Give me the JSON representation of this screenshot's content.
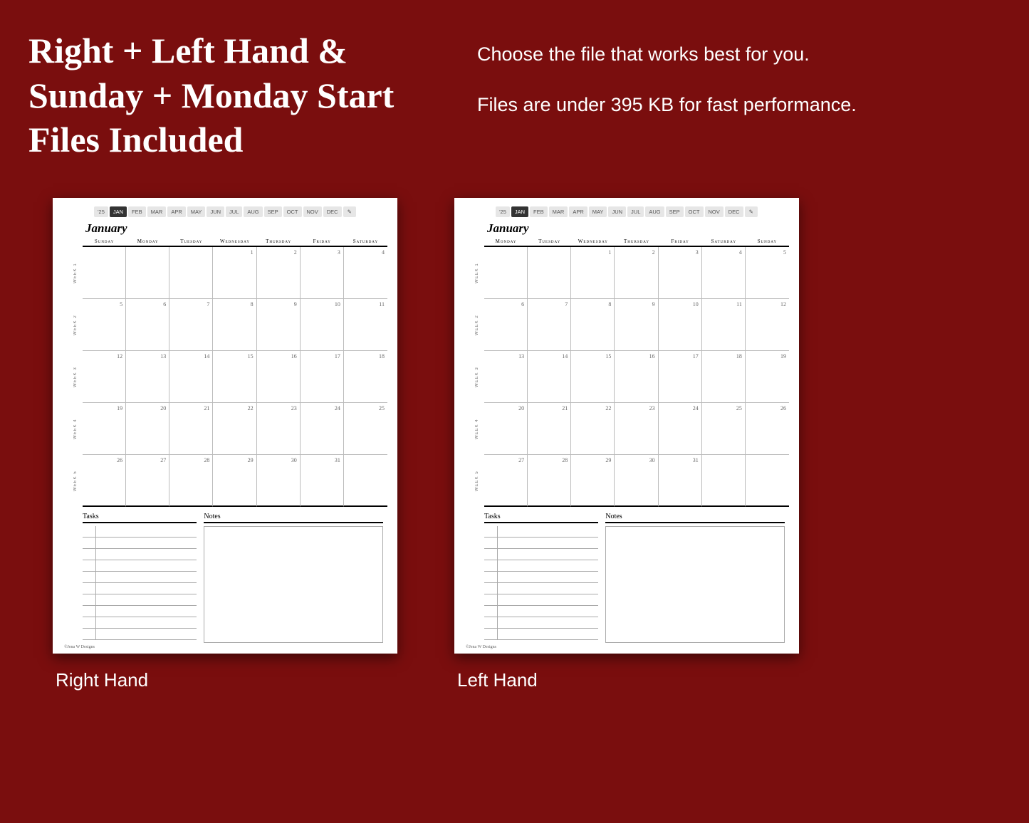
{
  "headline": "Right + Left Hand  & Sunday + Monday Start Files Included",
  "desc_line1": "Choose the file that works best for you.",
  "desc_line2": "Files are under 395 KB for fast performance.",
  "nav": {
    "year": "'25",
    "months": [
      "JAN",
      "FEB",
      "MAR",
      "APR",
      "MAY",
      "JUN",
      "JUL",
      "AUG",
      "SEP",
      "OCT",
      "NOV",
      "DEC"
    ],
    "active": "JAN"
  },
  "month_title": "January",
  "week_labels": [
    "WEEK 1",
    "WEEK 2",
    "WEEK 3",
    "WEEK 4",
    "WEEK 5"
  ],
  "right_hand": {
    "caption": "Right Hand",
    "day_headers": [
      "Sunday",
      "Monday",
      "Tuesday",
      "Wednesday",
      "Thursday",
      "Friday",
      "Saturday"
    ],
    "cells": [
      "",
      "",
      "",
      "1",
      "2",
      "3",
      "4",
      "5",
      "6",
      "7",
      "8",
      "9",
      "10",
      "11",
      "12",
      "13",
      "14",
      "15",
      "16",
      "17",
      "18",
      "19",
      "20",
      "21",
      "22",
      "23",
      "24",
      "25",
      "26",
      "27",
      "28",
      "29",
      "30",
      "31",
      ""
    ]
  },
  "left_hand": {
    "caption": "Left Hand",
    "day_headers": [
      "Monday",
      "Tuesday",
      "Wednesday",
      "Thursday",
      "Friday",
      "Saturday",
      "Sunday"
    ],
    "cells": [
      "",
      "",
      "1",
      "2",
      "3",
      "4",
      "5",
      "6",
      "7",
      "8",
      "9",
      "10",
      "11",
      "12",
      "13",
      "14",
      "15",
      "16",
      "17",
      "18",
      "19",
      "20",
      "21",
      "22",
      "23",
      "24",
      "25",
      "26",
      "27",
      "28",
      "29",
      "30",
      "31",
      "",
      ""
    ]
  },
  "sections": {
    "tasks": "Tasks",
    "notes": "Notes"
  },
  "credit": "©Jena W Designs"
}
